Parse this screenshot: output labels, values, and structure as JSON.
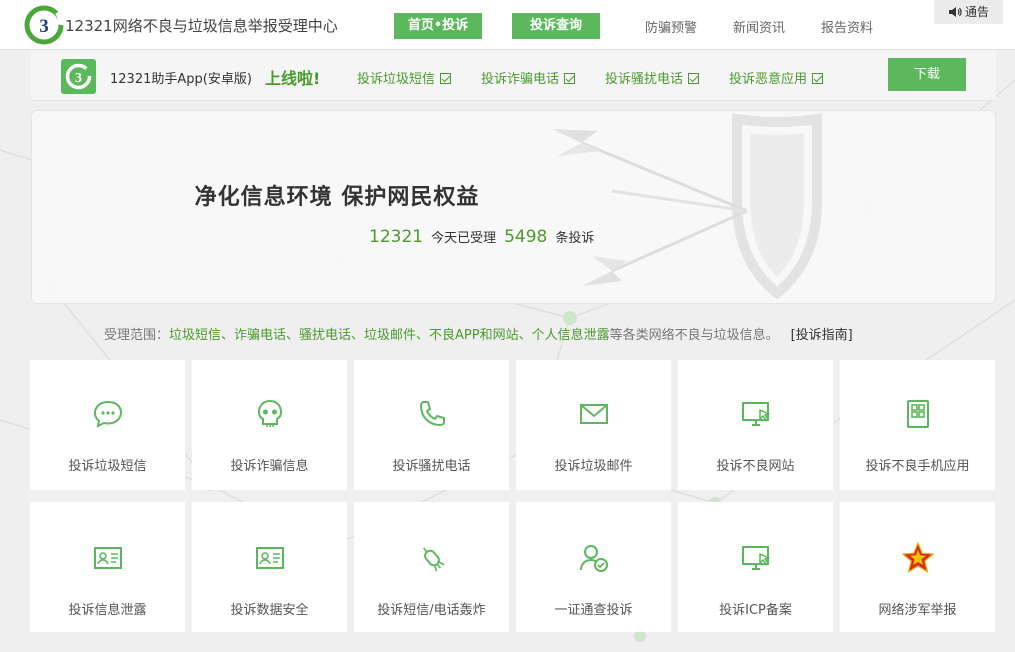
{
  "header": {
    "site_title": "12321网络不良与垃圾信息举报受理中心",
    "nav_home": "首页•投诉",
    "nav_query": "投诉查询",
    "nav_links": [
      "防骗预警",
      "新闻资讯",
      "报告资料"
    ],
    "notice": "通告"
  },
  "appbar": {
    "app_name": "12321助手App(安卓版)",
    "online": "上线啦!",
    "features": [
      "投诉垃圾短信",
      "投诉诈骗电话",
      "投诉骚扰电话",
      "投诉恶意应用"
    ],
    "download": "下载"
  },
  "banner": {
    "slogan": "净化信息环境 保护网民权益",
    "today_count": "12321",
    "today_label": "今天已受理",
    "total_count": "5498",
    "total_label": "条投诉"
  },
  "scope": {
    "prefix": "受理范围：",
    "items": "垃圾短信、诈骗电话、骚扰电话、垃圾邮件、不良APP和网站、个人信息泄露",
    "suffix": "等各类网络不良与垃圾信息。",
    "guide": "[投诉指南]"
  },
  "cards": [
    {
      "label": "投诉垃圾短信",
      "icon": "chat-bubble-icon"
    },
    {
      "label": "投诉诈骗信息",
      "icon": "skull-icon"
    },
    {
      "label": "投诉骚扰电话",
      "icon": "phone-icon"
    },
    {
      "label": "投诉垃圾邮件",
      "icon": "envelope-icon"
    },
    {
      "label": "投诉不良网站",
      "icon": "monitor-cursor-icon"
    },
    {
      "label": "投诉不良手机应用",
      "icon": "app-grid-icon"
    },
    {
      "label": "投诉信息泄露",
      "icon": "id-card-icon"
    },
    {
      "label": "投诉数据安全",
      "icon": "id-card-icon"
    },
    {
      "label": "投诉短信/电话轰炸",
      "icon": "bomb-icon"
    },
    {
      "label": "一证通查投诉",
      "icon": "user-check-icon"
    },
    {
      "label": "投诉ICP备案",
      "icon": "monitor-cursor-icon"
    },
    {
      "label": "网络涉军举报",
      "icon": "army-star-icon"
    }
  ],
  "colors": {
    "accent": "#5cb85c",
    "accent_text": "#4a9a2e",
    "background": "#efefef"
  }
}
